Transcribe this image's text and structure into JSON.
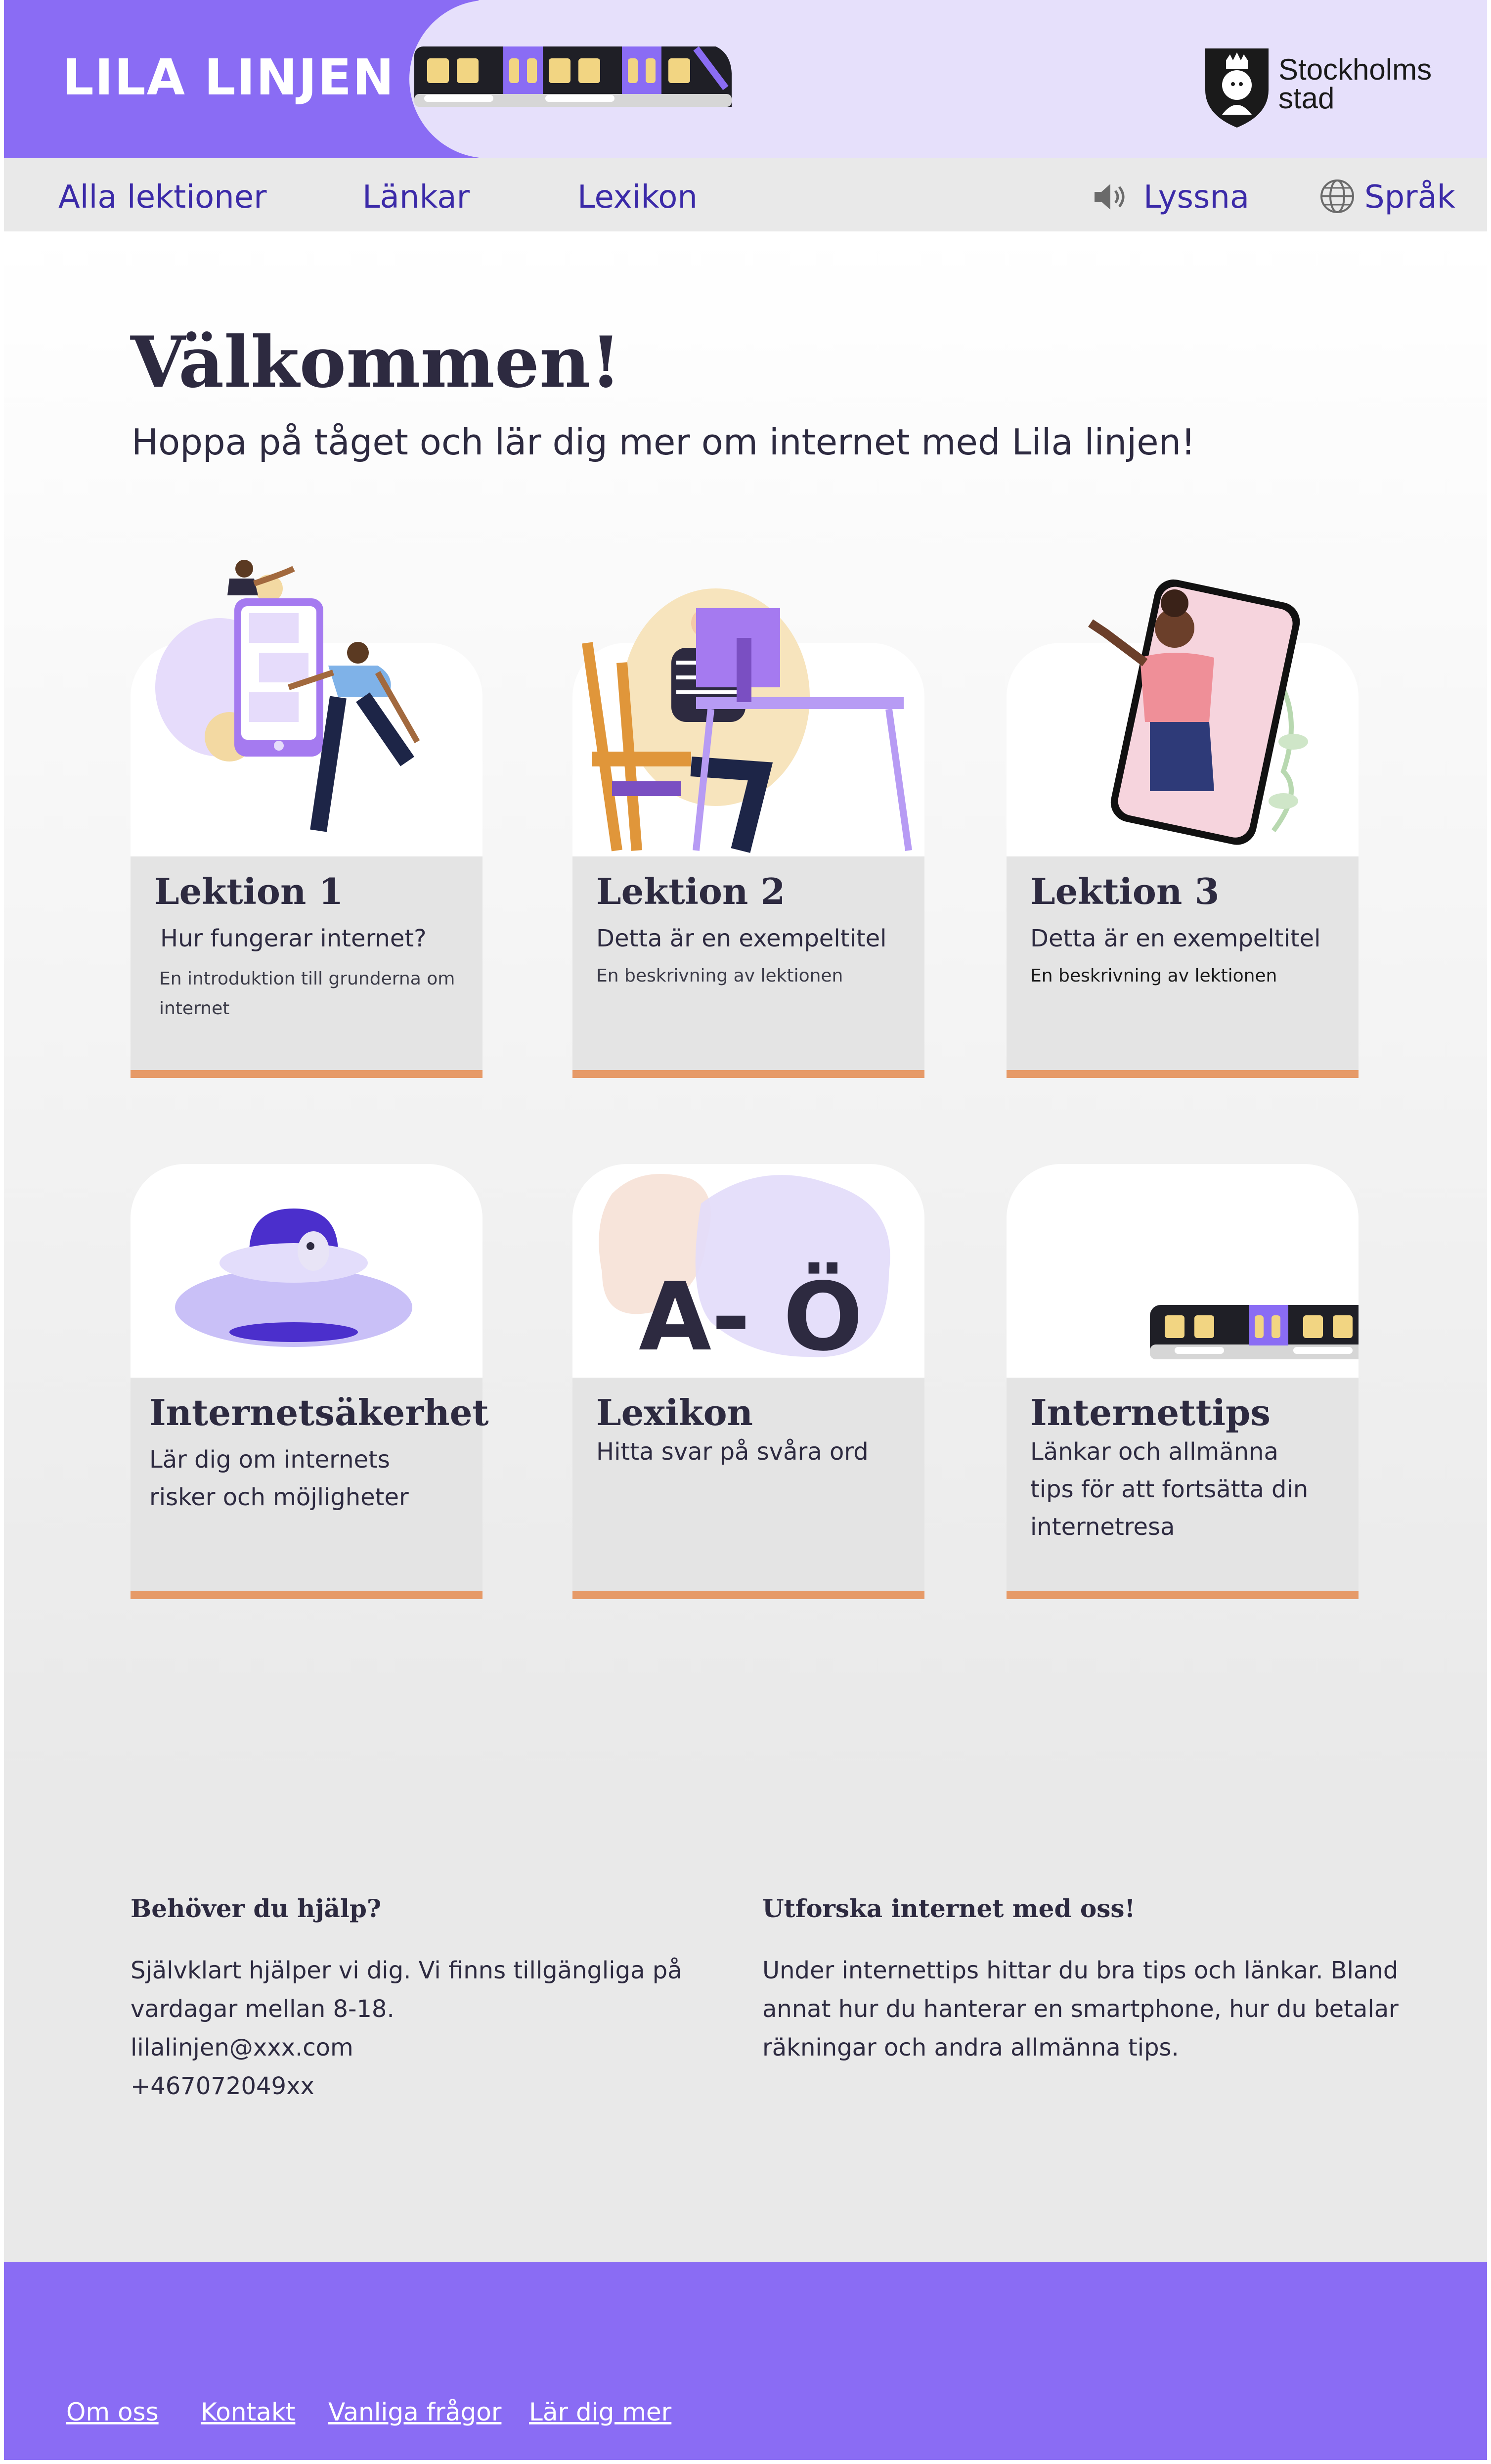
{
  "header": {
    "brand": "LILA LINJEN",
    "city_logo_line1": "Stockholms",
    "city_logo_line2": "stad"
  },
  "nav": {
    "items": [
      "Alla lektioner",
      "Länkar",
      "Lexikon"
    ],
    "listen": "Lyssna",
    "language": "Språk"
  },
  "hero": {
    "title": "Välkommen!",
    "lead": "Hoppa på tåget och lär dig mer om internet med Lila linjen!"
  },
  "cards": [
    {
      "title": "Lektion 1",
      "subtitle": "Hur fungerar internet?",
      "desc": "En introduktion till grunderna om internet"
    },
    {
      "title": "Lektion 2",
      "subtitle": "Detta är en exempeltitel",
      "desc": "En beskrivning av lektionen"
    },
    {
      "title": "Lektion 3",
      "subtitle": "Detta är en exempeltitel",
      "desc": "En beskrivning av lektionen"
    },
    {
      "title": "Internetsäkerhet",
      "subtitle": "Lär dig om internets risker och möjligheter",
      "desc": ""
    },
    {
      "title": "Lexikon",
      "subtitle": "Hitta svar på svåra ord",
      "desc": "",
      "art_text": "A- Ö"
    },
    {
      "title": "Internettips",
      "subtitle": "Länkar och allmänna tips för att fortsätta din internetresa",
      "desc": ""
    }
  ],
  "info": {
    "help_title": "Behöver du hjälp?",
    "help_lines": [
      "Självklart hjälper vi dig. Vi finns tillgängliga på",
      "vardagar mellan 8-18.",
      "lilalinjen@xxx.com",
      "+467072049xx"
    ],
    "explore_title": "Utforska internet med oss!",
    "explore_lines": [
      "Under internettips hittar du bra tips och länkar. Bland",
      "annat hur du hanterar en smartphone, hur du betalar",
      "räkningar och andra allmänna tips."
    ]
  },
  "footer": {
    "links": [
      "Om oss",
      "Kontakt",
      "Vanliga frågor",
      "Lär dig mer"
    ]
  },
  "colors": {
    "brand_purple": "#8a6cf4",
    "header_lavender": "#e6e0fb",
    "nav_text": "#3b2aa8",
    "accent_orange": "#e69a68",
    "card_body": "#e4e4e4"
  },
  "icons": [
    "train-icon",
    "stockholm-crest-icon",
    "speaker-icon",
    "globe-icon",
    "ufo-icon"
  ]
}
